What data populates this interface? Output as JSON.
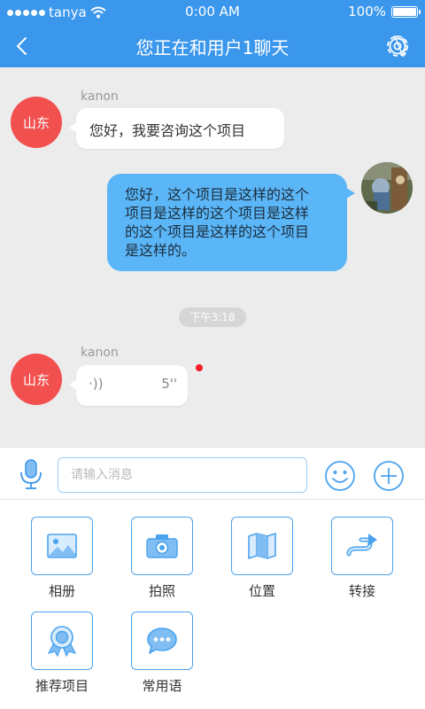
{
  "status_bar": {
    "carrier": "tanya",
    "time": "0:00 AM",
    "battery": "100%"
  },
  "nav": {
    "title": "您正在和用户1聊天"
  },
  "messages": {
    "first": {
      "sender": "kanon",
      "avatar_text": "山东",
      "text": "您好，我要咨询这个项目"
    },
    "reply": {
      "lines": [
        "您好，这个项目是这样的这个",
        "项目是这样的这个项目是这样",
        "的这个项目是这样的这个项目",
        "是这样的。"
      ]
    },
    "timestamp": "下午3:18",
    "voice": {
      "sender": "kanon",
      "avatar_text": "山东",
      "duration": "5''",
      "wave_glyph": "·))"
    }
  },
  "input": {
    "placeholder": "请输入消息",
    "value": ""
  },
  "tools": [
    {
      "label": "相册",
      "icon": "photo-album-icon"
    },
    {
      "label": "拍照",
      "icon": "camera-icon"
    },
    {
      "label": "位置",
      "icon": "map-location-icon"
    },
    {
      "label": "转接",
      "icon": "transfer-icon"
    },
    {
      "label": "推荐项目",
      "icon": "recommend-badge-icon"
    },
    {
      "label": "常用语",
      "icon": "common-phrases-icon"
    }
  ],
  "colors": {
    "brand": "#3a97ec",
    "avatar_red": "#f2504f",
    "bubble_blue": "#5bb6f7",
    "unread": "#f21d2a"
  }
}
